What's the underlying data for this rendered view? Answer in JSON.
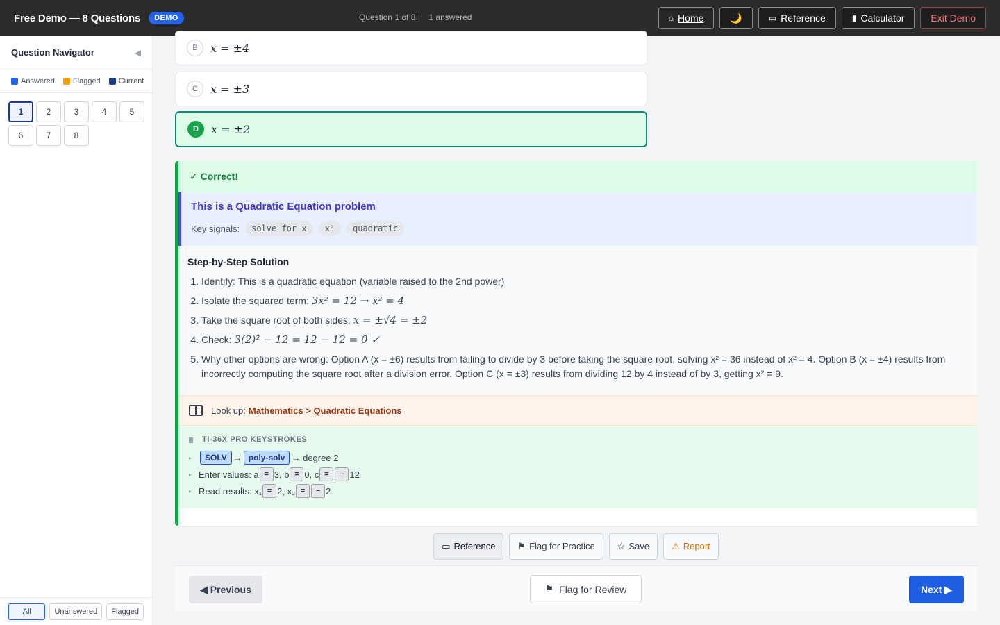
{
  "header": {
    "title": "Free Demo — 8 Questions",
    "badge": "DEMO",
    "progress": "Question 1 of 8",
    "answered": "1 answered",
    "buttons": {
      "home": "Home",
      "theme": "🌙",
      "reference": "Reference",
      "calculator": "Calculator",
      "exit": "Exit Demo"
    }
  },
  "sidebar": {
    "title": "Question Navigator",
    "legend": {
      "answered": "Answered",
      "flagged": "Flagged",
      "current": "Current"
    },
    "questions": [
      "1",
      "2",
      "3",
      "4",
      "5",
      "6",
      "7",
      "8"
    ],
    "current": "1",
    "filters": {
      "all": "All",
      "unanswered": "Unanswered",
      "flagged": "Flagged"
    }
  },
  "options": [
    {
      "letter": "B",
      "text": "x = ±4"
    },
    {
      "letter": "C",
      "text": "x = ±3"
    },
    {
      "letter": "D",
      "text": "x = ±2",
      "selected": true
    }
  ],
  "feedback": {
    "status": "✓ Correct!",
    "problem_type": "This is a Quadratic Equation problem",
    "signals_label": "Key signals:",
    "signals": [
      "solve for x",
      "x²",
      "quadratic"
    ],
    "solution_title": "Step-by-Step Solution",
    "steps": {
      "s1": "Identify: This is a quadratic equation (variable raised to the 2nd power)",
      "s2_label": "Isolate the squared term:",
      "s2_math": "3x² = 12 → x² = 4",
      "s3_label": "Take the square root of both sides:",
      "s3_math": "x = ±√4 = ±2",
      "s4_label": "Check:",
      "s4_math": "3(2)² − 12 = 12 − 12 = 0 ✓",
      "s5": "Why other options are wrong: Option A (x = ±6) results from failing to divide by 3 before taking the square root, solving x² = 36 instead of x² = 4. Option B (x = ±4) results from incorrectly computing the square root after a division error. Option C (x = ±3) results from dividing 12 by 4 instead of by 3, getting x² = 9."
    },
    "lookup_label": "Look up:",
    "lookup_link": "Mathematics > Quadratic Equations",
    "keystrokes_title": "TI-36X PRO KEYSTROKES",
    "keystrokes": {
      "row1": {
        "key1": "SOLV",
        "key2": "poly-solv",
        "suffix": "→ degree 2",
        "arrow": "→"
      },
      "row2": {
        "prefix": "Enter values: a",
        "v1": "3, b",
        "v2": "0, c",
        "v3": "12"
      },
      "row3": {
        "prefix": "Read results: x₁",
        "v1": "2, x₂",
        "v2": "2"
      },
      "equals": "=",
      "minus": "−"
    }
  },
  "actions": {
    "reference": "Reference",
    "flag_practice": "Flag for Practice",
    "save": "Save",
    "report": "Report"
  },
  "navigation": {
    "previous": "◀ Previous",
    "flag_review": "Flag for Review",
    "next": "Next ▶"
  },
  "colors": {
    "answered": "#2563eb",
    "flagged": "#f59e0b",
    "current": "#1e3a8a",
    "correct": "#16a34a",
    "accent": "#1d5fe0"
  }
}
